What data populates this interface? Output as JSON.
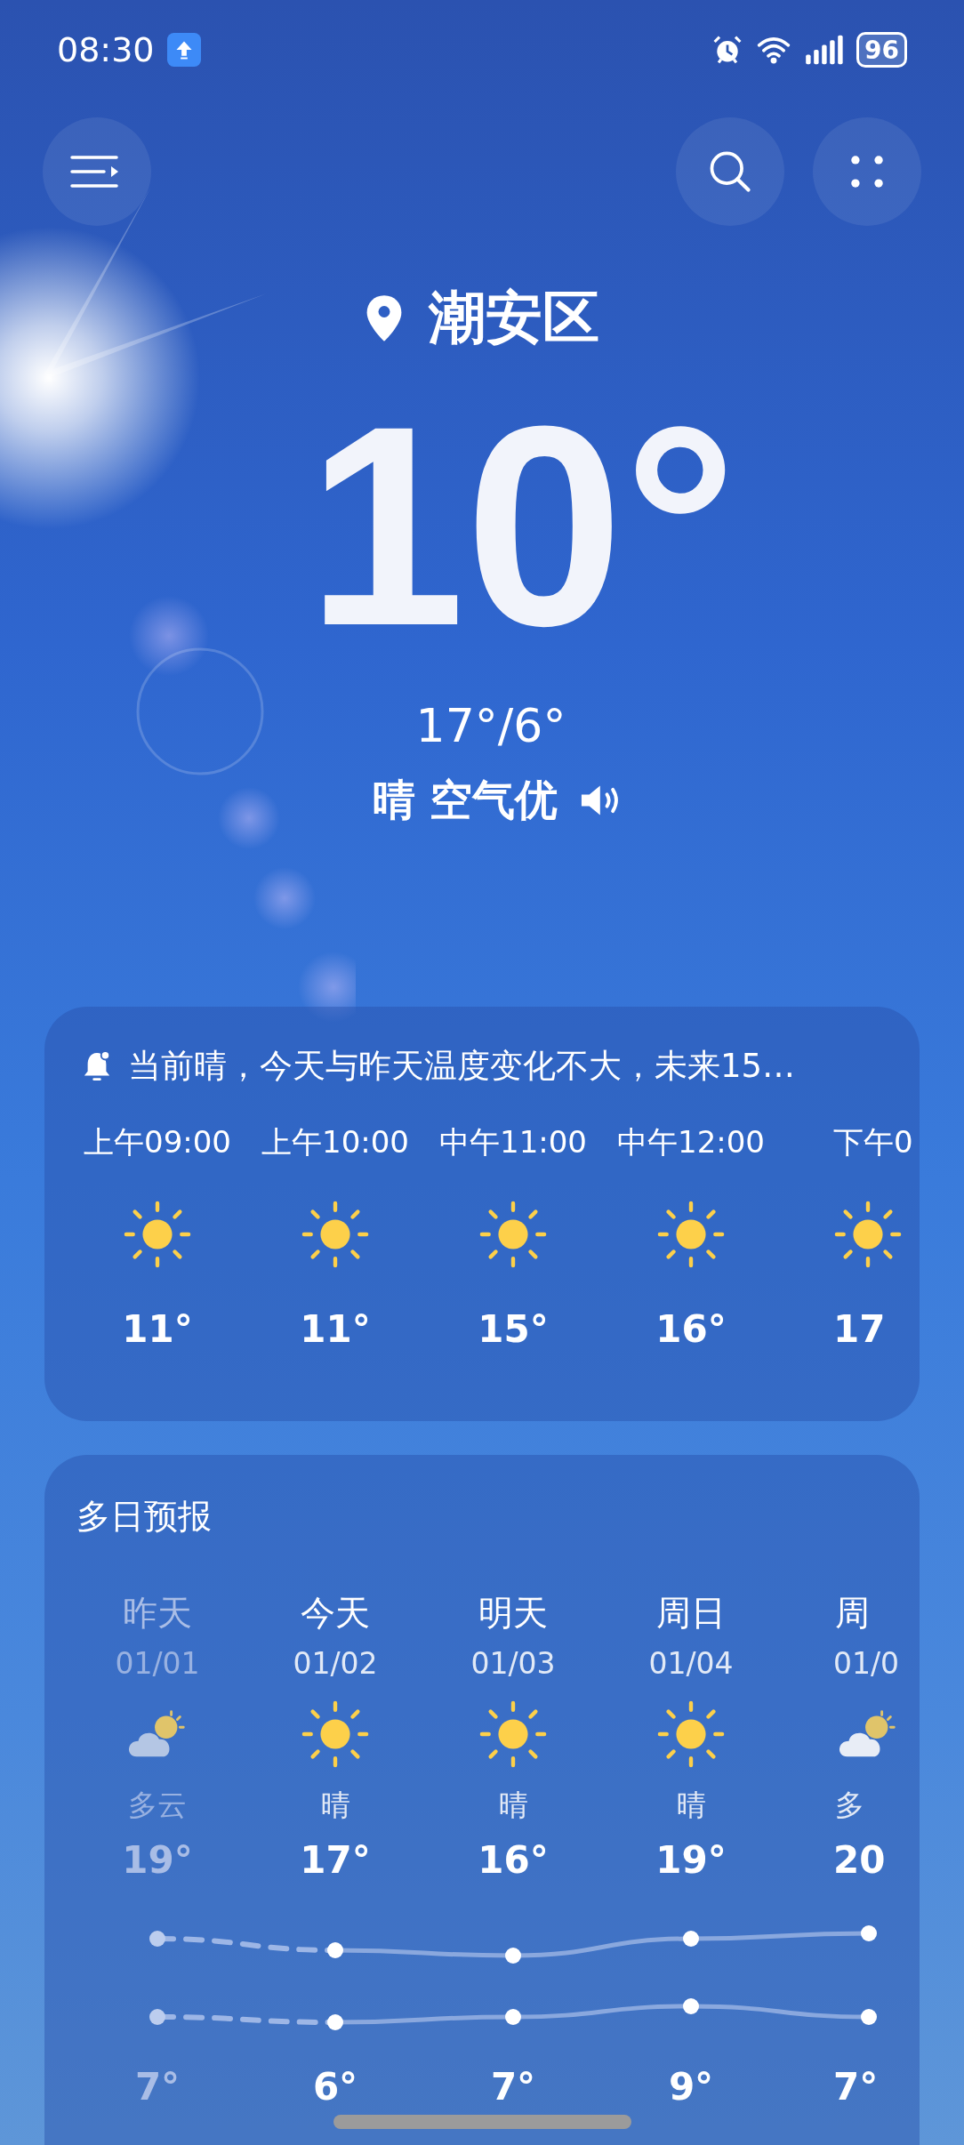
{
  "status_bar": {
    "time": "08:30",
    "battery": "96"
  },
  "location": "潮安区",
  "current": {
    "temperature": "10°",
    "range": "17°/6°",
    "summary": "晴 空气优"
  },
  "hourly": {
    "alert": "当前晴，今天与昨天温度变化不大，未来15…",
    "hours": [
      {
        "time": "上午09:00",
        "kind": "sunny",
        "temperature": "11°"
      },
      {
        "time": "上午10:00",
        "kind": "sunny",
        "temperature": "11°"
      },
      {
        "time": "中午11:00",
        "kind": "sunny",
        "temperature": "15°"
      },
      {
        "time": "中午12:00",
        "kind": "sunny",
        "temperature": "16°"
      },
      {
        "time": "下午0",
        "kind": "sunny",
        "temperature": "17"
      }
    ]
  },
  "daily": {
    "title": "多日预报",
    "days": [
      {
        "day": "昨天",
        "date": "01/01",
        "kind": "cloudy",
        "condition": "多云",
        "high": "19°",
        "low": "7°",
        "past": true
      },
      {
        "day": "今天",
        "date": "01/02",
        "kind": "sunny",
        "condition": "晴",
        "high": "17°",
        "low": "6°",
        "past": false
      },
      {
        "day": "明天",
        "date": "01/03",
        "kind": "sunny",
        "condition": "晴",
        "high": "16°",
        "low": "7°",
        "past": false
      },
      {
        "day": "周日",
        "date": "01/04",
        "kind": "sunny",
        "condition": "晴",
        "high": "19°",
        "low": "9°",
        "past": false
      },
      {
        "day": "周",
        "date": "01/0",
        "kind": "cloudy",
        "condition": "多",
        "high": "20",
        "low": "7°",
        "past": false
      }
    ]
  }
}
